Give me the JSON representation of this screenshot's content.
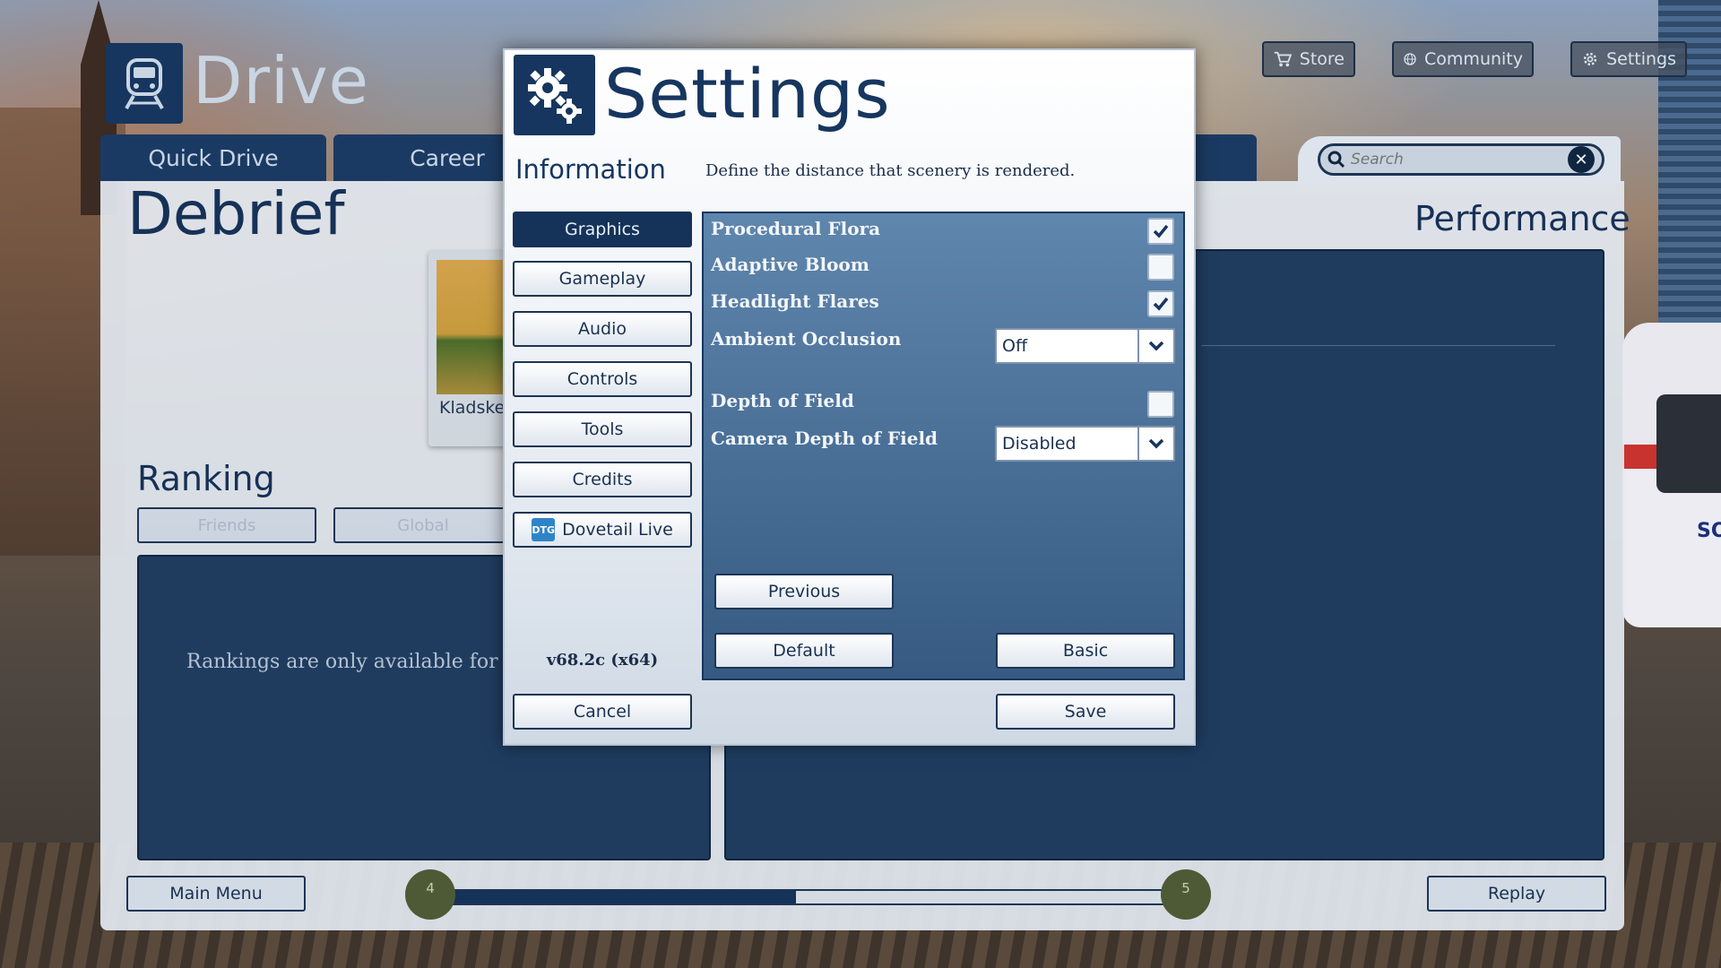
{
  "app": {
    "logo_text": "Drive"
  },
  "top_bar": {
    "store": "Store",
    "community": "Community",
    "settings": "Settings"
  },
  "tabs": [
    "Quick Drive",
    "Career"
  ],
  "search": {
    "placeholder": "Search"
  },
  "debrief": {
    "title": "Debrief",
    "performance_title": "Performance",
    "route_name": "Kladske",
    "ranking_title": "Ranking",
    "ranking_buttons": [
      "Friends",
      "Global"
    ],
    "ranking_message": "Rankings are only available for C",
    "main_menu": "Main Menu",
    "replay": "Replay",
    "progress": {
      "start_label": "4",
      "end_label": "5",
      "fill_fraction": 0.485
    }
  },
  "modal": {
    "title": "Settings",
    "section_label": "Information",
    "description": "Define the distance that scenery is rendered.",
    "side_buttons": [
      "Graphics",
      "Gameplay",
      "Audio",
      "Controls",
      "Tools",
      "Credits",
      "Dovetail Live"
    ],
    "active_side_button": "Graphics",
    "dovetail_icon_text": "DTG",
    "version": "v68.2c (x64)",
    "settings_rows": {
      "procedural_flora": {
        "label": "Procedural Flora",
        "checked": true
      },
      "adaptive_bloom": {
        "label": "Adaptive Bloom",
        "checked": false
      },
      "headlight_flares": {
        "label": "Headlight Flares",
        "checked": true
      },
      "ambient_occlusion": {
        "label": "Ambient Occlusion",
        "value": "Off"
      },
      "depth_of_field": {
        "label": "Depth of Field",
        "checked": false
      },
      "camera_depth_of_field": {
        "label": "Camera Depth of Field",
        "value": "Disabled"
      }
    },
    "previous": "Previous",
    "default": "Default",
    "basic": "Basic",
    "cancel": "Cancel",
    "save": "Save"
  },
  "colors": {
    "navy": "#16365f",
    "pane_top": "#5f86ad",
    "pane_bottom": "#365a82",
    "active_button": "#153258"
  }
}
